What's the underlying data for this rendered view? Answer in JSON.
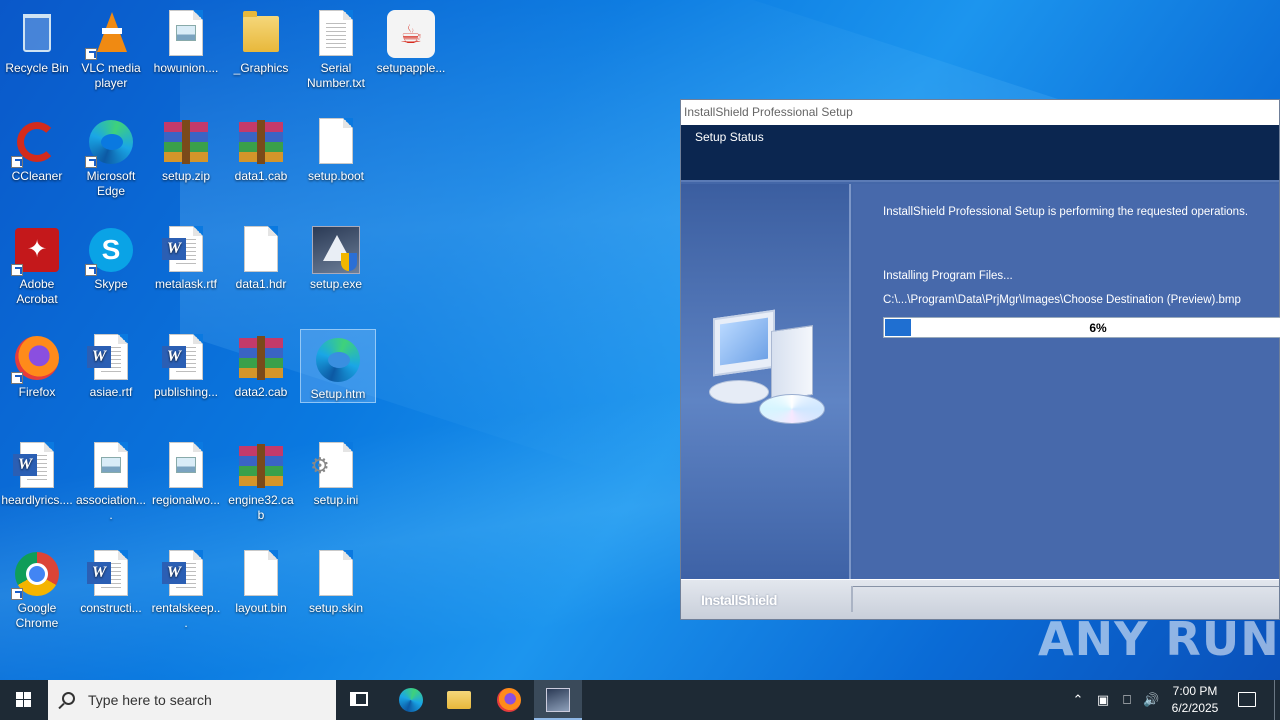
{
  "desktop": {
    "icons": [
      {
        "label": "Recycle Bin",
        "icon": "recycle-bin-icon"
      },
      {
        "label": "VLC media player",
        "icon": "vlc-icon"
      },
      {
        "label": "howunion....",
        "icon": "image-file-icon"
      },
      {
        "label": "_Graphics",
        "icon": "folder-icon"
      },
      {
        "label": "Serial Number.txt",
        "icon": "text-file-icon"
      },
      {
        "label": "setupapple...",
        "icon": "java-icon"
      },
      {
        "label": "CCleaner",
        "icon": "ccleaner-icon"
      },
      {
        "label": "Microsoft Edge",
        "icon": "edge-icon"
      },
      {
        "label": "setup.zip",
        "icon": "winrar-archive-icon"
      },
      {
        "label": "data1.cab",
        "icon": "winrar-archive-icon"
      },
      {
        "label": "setup.boot",
        "icon": "blank-file-icon"
      },
      {
        "label": "Adobe Acrobat",
        "icon": "acrobat-icon"
      },
      {
        "label": "Skype",
        "icon": "skype-icon"
      },
      {
        "label": "metalask.rtf",
        "icon": "word-document-icon"
      },
      {
        "label": "data1.hdr",
        "icon": "blank-file-icon"
      },
      {
        "label": "setup.exe",
        "icon": "installer-exe-icon"
      },
      {
        "label": "Firefox",
        "icon": "firefox-icon"
      },
      {
        "label": "asiae.rtf",
        "icon": "word-document-icon"
      },
      {
        "label": "publishing...",
        "icon": "word-document-icon"
      },
      {
        "label": "data2.cab",
        "icon": "winrar-archive-icon"
      },
      {
        "label": "Setup.htm",
        "icon": "edge-icon"
      },
      {
        "label": "heardlyrics....",
        "icon": "word-document-icon"
      },
      {
        "label": "association....",
        "icon": "image-file-icon"
      },
      {
        "label": "regionalwo...",
        "icon": "image-file-icon"
      },
      {
        "label": "engine32.cab",
        "icon": "winrar-archive-icon"
      },
      {
        "label": "setup.ini",
        "icon": "settings-file-icon"
      },
      {
        "label": "Google Chrome",
        "icon": "chrome-icon"
      },
      {
        "label": "constructi...",
        "icon": "word-document-icon"
      },
      {
        "label": "rentalskeep...",
        "icon": "word-document-icon"
      },
      {
        "label": "layout.bin",
        "icon": "blank-file-icon"
      },
      {
        "label": "setup.skin",
        "icon": "blank-file-icon"
      }
    ]
  },
  "installer": {
    "window_title": "InstallShield Professional Setup",
    "header_title": "Setup Status",
    "status_message": "InstallShield Professional Setup is performing the requested operations.",
    "action_label": "Installing Program Files...",
    "current_file": "C:\\...\\Program\\Data\\PrjMgr\\Images\\Choose Destination (Preview).bmp",
    "progress_text": "6%",
    "progress_fraction": 0.06,
    "brand": "InstallShield"
  },
  "watermark": "ANY RUN",
  "taskbar": {
    "search_placeholder": "Type here to search",
    "time": "7:00 PM",
    "date": "6/2/2025",
    "pinned": [
      "task-view-icon",
      "edge-icon",
      "file-explorer-icon",
      "firefox-icon",
      "setup-installer-icon"
    ]
  }
}
